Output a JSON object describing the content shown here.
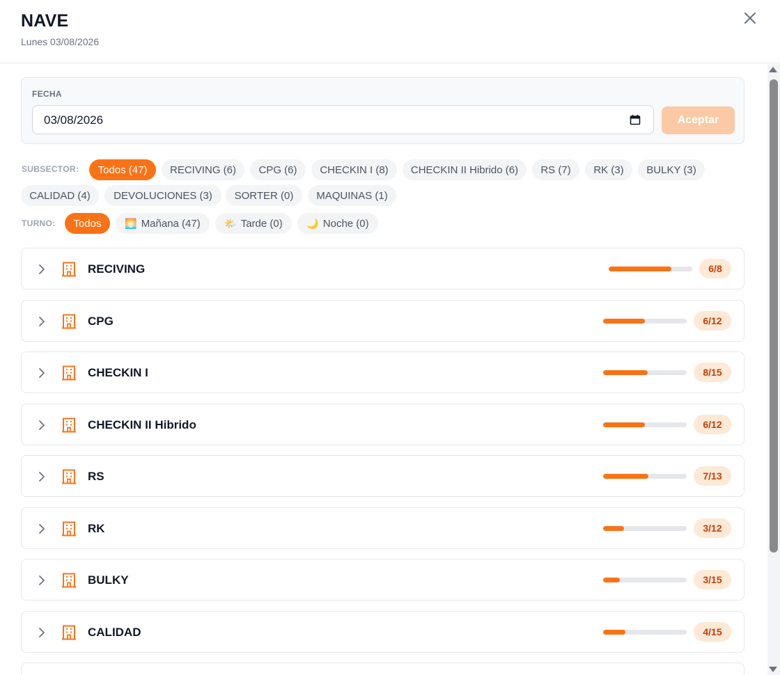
{
  "header": {
    "title": "NAVE",
    "subtitle": "Lunes 03/08/2026"
  },
  "filter": {
    "fecha_label": "FECHA",
    "date_value": "03/08/2026",
    "accept_label": "Aceptar"
  },
  "subsector": {
    "label": "SUBSECTOR:",
    "chips": [
      {
        "label": "Todos (47)",
        "active": true
      },
      {
        "label": "RECIVING (6)"
      },
      {
        "label": "CPG (6)"
      },
      {
        "label": "CHECKIN I (8)"
      },
      {
        "label": "CHECKIN II Hibrido (6)"
      },
      {
        "label": "RS (7)"
      },
      {
        "label": "RK (3)"
      },
      {
        "label": "BULKY (3)"
      },
      {
        "label": "CALIDAD (4)"
      },
      {
        "label": "DEVOLUCIONES (3)"
      },
      {
        "label": "SORTER (0)"
      },
      {
        "label": "MAQUINAS (1)"
      }
    ]
  },
  "turno": {
    "label": "TURNO:",
    "chips": [
      {
        "label": "Todos",
        "active": true
      },
      {
        "label": "Mañana (47)",
        "emoji": "🌅"
      },
      {
        "label": "Tarde (0)",
        "emoji": "🌤️"
      },
      {
        "label": "Noche (0)",
        "emoji": "🌙"
      }
    ]
  },
  "sectors": [
    {
      "name": "RECIVING",
      "count": "6/8",
      "progress": 0.75
    },
    {
      "name": "CPG",
      "count": "6/12",
      "progress": 0.5
    },
    {
      "name": "CHECKIN I",
      "count": "8/15",
      "progress": 0.533
    },
    {
      "name": "CHECKIN II Hibrido",
      "count": "6/12",
      "progress": 0.5
    },
    {
      "name": "RS",
      "count": "7/13",
      "progress": 0.538
    },
    {
      "name": "RK",
      "count": "3/12",
      "progress": 0.25
    },
    {
      "name": "BULKY",
      "count": "3/15",
      "progress": 0.2
    },
    {
      "name": "CALIDAD",
      "count": "4/15",
      "progress": 0.267
    }
  ],
  "colors": {
    "accent": "#f97316",
    "badge_bg": "#fde9d6",
    "badge_text": "#c2410c",
    "accept_disabled": "#fbc9a4"
  }
}
